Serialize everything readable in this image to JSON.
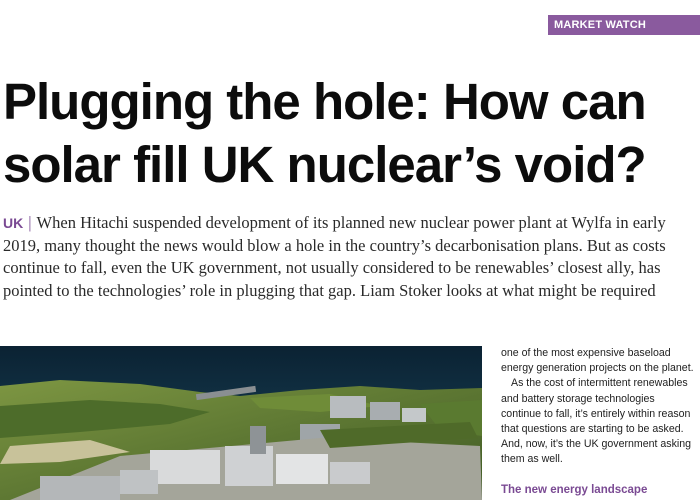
{
  "section_tag": "MARKET WATCH",
  "headline": {
    "line1": "Plugging the hole: How can",
    "line2": "solar fill UK nuclear’s void?"
  },
  "standfirst": {
    "country": "UK",
    "separator": "|",
    "text": "When Hitachi suspended development of its planned new nuclear power plant at Wylfa in early 2019, many thought the news would blow a hole in the country’s decarbonisation plans. But as costs continue to fall, even the UK government, not usually considered to be renewables’ closest ally, has pointed to the technologies’ role in plugging that gap. Liam Stoker looks at what might be required"
  },
  "body": {
    "p1": "one of the most expensive baseload energy generation projects on the planet.",
    "p2": "As the cost of intermittent renewables and battery storage technologies continue to fall, it’s entirely within reason that questions are starting to be asked. And, now, it’s the UK government asking them as well."
  },
  "subhead": "The new energy landscape",
  "colors": {
    "accent": "#7a4a93",
    "tag_bg": "#8a5a9e",
    "sea": "#0f2f44",
    "land": "#5e7b34"
  },
  "image": {
    "subject": "aerial-rendering-nuclear-plant"
  }
}
